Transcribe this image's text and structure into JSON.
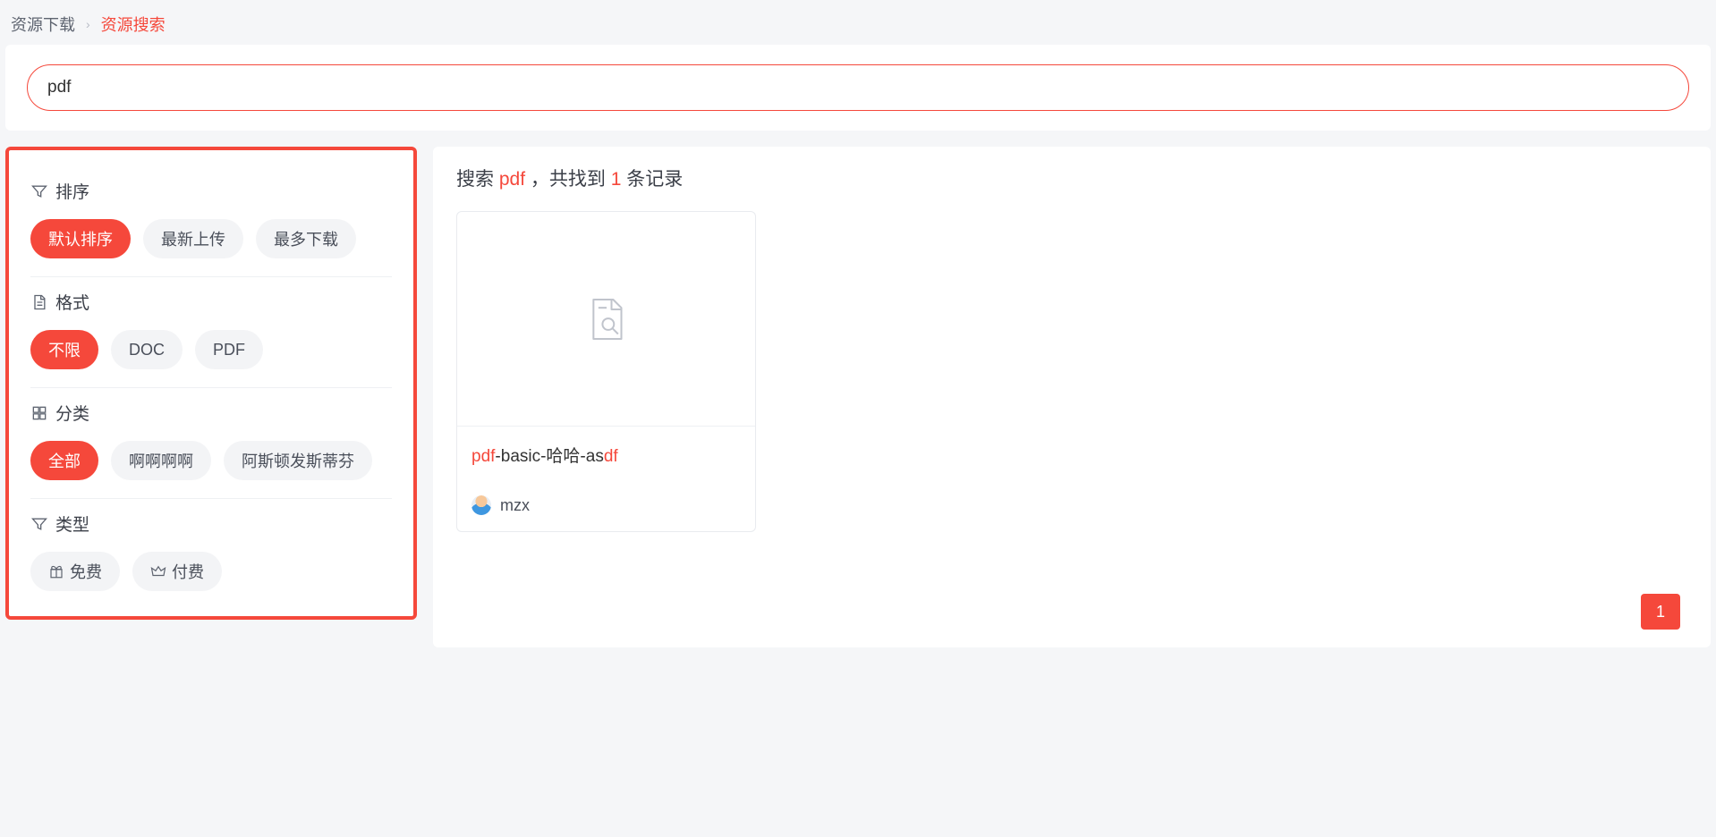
{
  "breadcrumb": {
    "root": "资源下载",
    "current": "资源搜索"
  },
  "search": {
    "value": "pdf"
  },
  "filters": {
    "sort": {
      "label": "排序",
      "options": [
        "默认排序",
        "最新上传",
        "最多下载"
      ],
      "active": 0
    },
    "format": {
      "label": "格式",
      "options": [
        "不限",
        "DOC",
        "PDF"
      ],
      "active": 0
    },
    "category": {
      "label": "分类",
      "options": [
        "全部",
        "啊啊啊啊",
        "阿斯顿发斯蒂芬"
      ],
      "active": 0
    },
    "type": {
      "label": "类型",
      "options": [
        "免费",
        "付费"
      ],
      "active": -1
    }
  },
  "results": {
    "header": {
      "prefix": "搜索 ",
      "term": "pdf",
      "mid": " ，共找到 ",
      "count": "1",
      "suffix": " 条记录"
    },
    "items": [
      {
        "title_parts": [
          {
            "t": "pdf",
            "hl": true
          },
          {
            "t": "-basic-哈哈-as",
            "hl": false
          },
          {
            "t": "df",
            "hl": true
          }
        ],
        "user": "mzx"
      }
    ]
  },
  "pagination": {
    "current": "1"
  }
}
